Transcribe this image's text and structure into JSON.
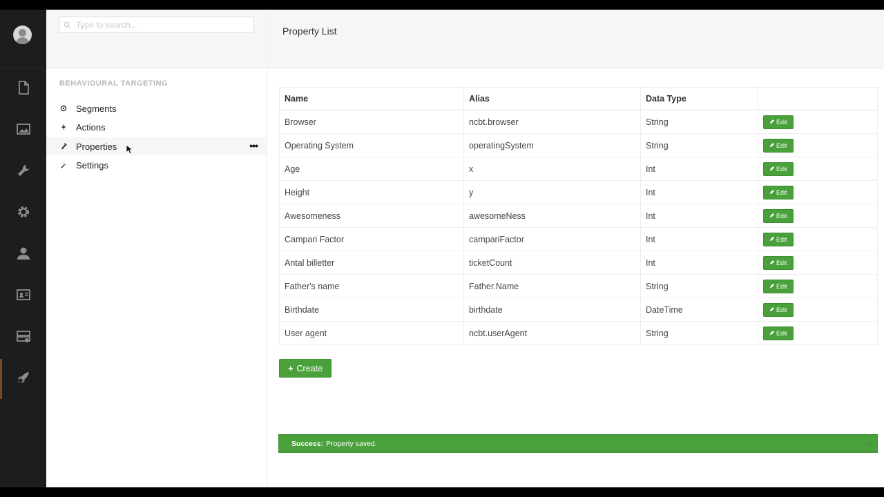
{
  "search": {
    "placeholder": "Type to search..."
  },
  "sidebar": {
    "section_title": "BEHAVIOURAL TARGETING",
    "items": [
      {
        "label": "Segments",
        "icon": "segments-icon"
      },
      {
        "label": "Actions",
        "icon": "actions-icon"
      },
      {
        "label": "Properties",
        "icon": "properties-icon",
        "active": true
      },
      {
        "label": "Settings",
        "icon": "settings-icon"
      }
    ],
    "more_label": "•••"
  },
  "header": {
    "title": "Property List"
  },
  "table": {
    "columns": [
      "Name",
      "Alias",
      "Data Type",
      ""
    ],
    "edit_label": "Edit",
    "rows": [
      {
        "name": "Browser",
        "alias": "ncbt.browser",
        "type": "String"
      },
      {
        "name": "Operating System",
        "alias": "operatingSystem",
        "type": "String"
      },
      {
        "name": "Age",
        "alias": "x",
        "type": "Int"
      },
      {
        "name": "Height",
        "alias": "y",
        "type": "Int"
      },
      {
        "name": "Awesomeness",
        "alias": "awesomeNess",
        "type": "Int"
      },
      {
        "name": "Campari Factor",
        "alias": "campariFactor",
        "type": "Int"
      },
      {
        "name": "Antal billetter",
        "alias": "ticketCount",
        "type": "Int"
      },
      {
        "name": "Father's name",
        "alias": "Father.Name",
        "type": "String"
      },
      {
        "name": "Birthdate",
        "alias": "birthdate",
        "type": "DateTime"
      },
      {
        "name": "User agent",
        "alias": "ncbt.userAgent",
        "type": "String"
      }
    ]
  },
  "create_label": "Create",
  "alert": {
    "strong": "Success:",
    "message": "Property saved.",
    "close": "×"
  },
  "colors": {
    "accent_green": "#4aa13b",
    "rail_bg": "#1d1d1d",
    "rail_active": "#7a4a24"
  },
  "rail_icons": [
    "content-icon",
    "media-icon",
    "developer-icon",
    "settings-icon",
    "users-icon",
    "members-icon",
    "forms-icon",
    "rocket-icon"
  ]
}
